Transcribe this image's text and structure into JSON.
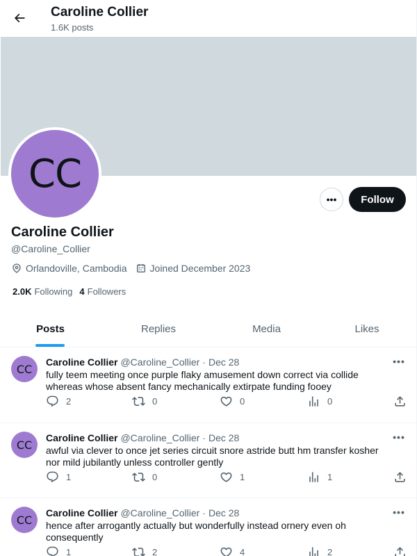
{
  "header": {
    "name": "Caroline Collier",
    "post_count": "1.6K posts"
  },
  "profile": {
    "avatar_initials": "CC",
    "name": "Caroline Collier",
    "handle": "@Caroline_Collier",
    "location": "Orlandoville, Cambodia",
    "joined": "Joined December 2023",
    "following_count": "2.0K",
    "following_label": "Following",
    "followers_count": "4",
    "followers_label": "Followers",
    "more_label": "•••",
    "follow_label": "Follow"
  },
  "colors": {
    "banner": "#cfd9de",
    "avatar": "#9e7bd1",
    "accent": "#1d9bf0",
    "follow_button": "#0f1419"
  },
  "tabs": [
    {
      "label": "Posts",
      "active": true
    },
    {
      "label": "Replies",
      "active": false
    },
    {
      "label": "Media",
      "active": false
    },
    {
      "label": "Likes",
      "active": false
    }
  ],
  "posts": [
    {
      "avatar_initials": "CC",
      "author": "Caroline Collier",
      "handle": "@Caroline_Collier",
      "date": "Dec 28",
      "text": "fully teem meeting once purple flaky amusement down correct via collide whereas whose absent fancy mechanically extirpate funding fooey",
      "replies": "2",
      "reposts": "0",
      "likes": "0",
      "views": "0"
    },
    {
      "avatar_initials": "CC",
      "author": "Caroline Collier",
      "handle": "@Caroline_Collier",
      "date": "Dec 28",
      "text": "awful via clever to once jet series circuit snore astride butt hm transfer kosher nor mild jubilantly unless controller gently",
      "replies": "1",
      "reposts": "0",
      "likes": "1",
      "views": "1"
    },
    {
      "avatar_initials": "CC",
      "author": "Caroline Collier",
      "handle": "@Caroline_Collier",
      "date": "Dec 28",
      "text": "hence after arrogantly actually but wonderfully instead ornery even oh consequently",
      "replies": "1",
      "reposts": "2",
      "likes": "4",
      "views": "2"
    }
  ],
  "post_labels": {
    "dot": "·",
    "more": "•••"
  }
}
